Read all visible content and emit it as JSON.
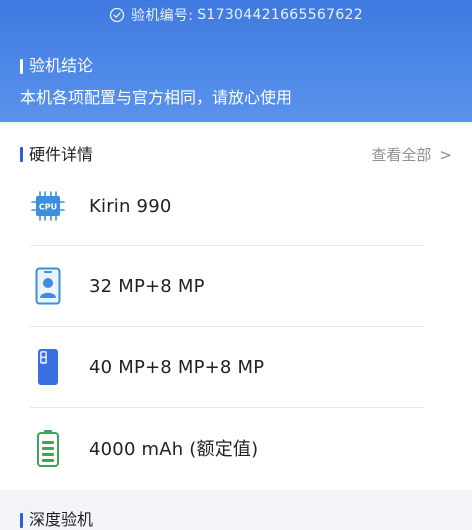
{
  "header": {
    "inspect_label": "验机编号:",
    "inspect_id": "S17304421665567622"
  },
  "conclusion": {
    "title": "验机结论",
    "message": "本机各项配置与官方相同，请放心使用"
  },
  "hardware": {
    "title": "硬件详情",
    "view_all": "查看全部",
    "items": [
      {
        "icon": "cpu-icon",
        "value": "Kirin 990"
      },
      {
        "icon": "front-camera-icon",
        "value": "32 MP+8 MP"
      },
      {
        "icon": "rear-camera-icon",
        "value": "40 MP+8 MP+8 MP"
      },
      {
        "icon": "battery-icon",
        "value": "4000 mAh (额定值)"
      }
    ]
  },
  "deep_inspection": {
    "title": "深度验机"
  },
  "colors": {
    "header_blue": "#4b85e6",
    "accent_blue": "#2b5fd4",
    "battery_green": "#3aa657"
  }
}
